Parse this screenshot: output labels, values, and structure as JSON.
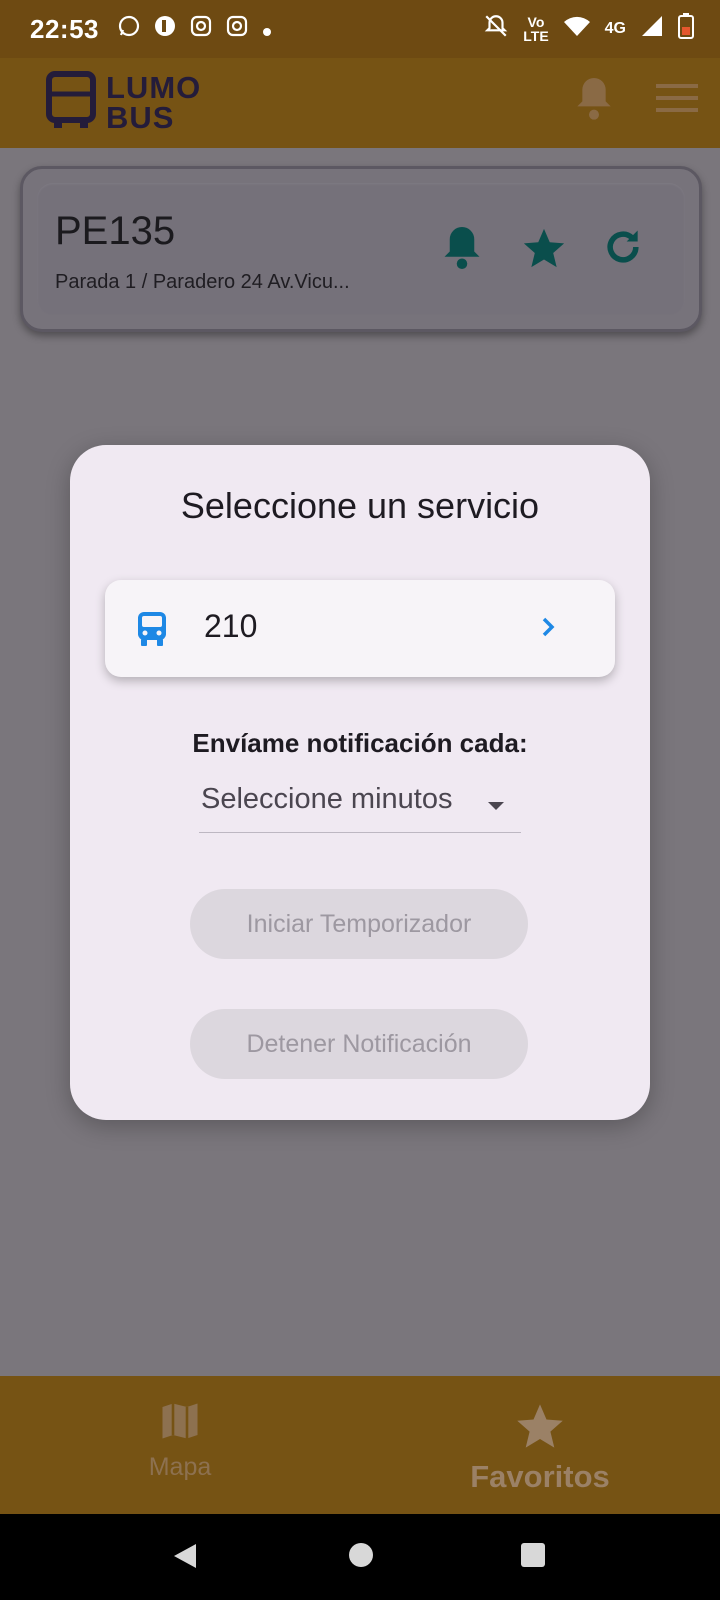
{
  "status_bar": {
    "time": "22:53",
    "icons": [
      "whatsapp-icon",
      "app-icon",
      "instagram-icon",
      "instagram-icon",
      "dot-icon"
    ],
    "volte_top": "Vo",
    "volte_bottom": "LTE",
    "network": "4G"
  },
  "header": {
    "logo_line1": "LUMO",
    "logo_line2": "BUS"
  },
  "stop": {
    "code": "PE135",
    "name": "Parada 1 / Paradero 24 Av.Vicu..."
  },
  "dialog": {
    "title": "Seleccione un servicio",
    "service_number": "210",
    "notify_label": "Envíame notificación cada:",
    "minutes_placeholder": "Seleccione minutos",
    "start_button": "Iniciar Temporizador",
    "stop_button": "Detener Notificación"
  },
  "bottom_nav": {
    "map_label": "Mapa",
    "favorites_label": "Favoritos"
  },
  "colors": {
    "header_bg": "#765314",
    "dialog_bg": "#f0e9f2",
    "accent_blue": "#1e88e5",
    "teal_icon": "#0a4e4c"
  }
}
